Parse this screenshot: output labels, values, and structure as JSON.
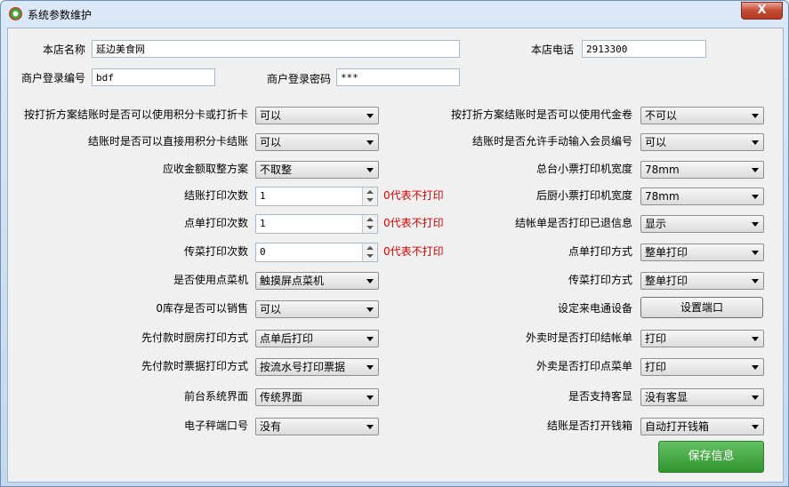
{
  "window": {
    "title": "系统参数维护",
    "close_label": "X"
  },
  "top": {
    "store_name_label": "本店名称",
    "store_name_value": "延边美食网",
    "store_phone_label": "本店电话",
    "store_phone_value": "2913300",
    "merchant_id_label": "商户登录编号",
    "merchant_id_value": "bdf",
    "merchant_pwd_label": "商户登录密码",
    "merchant_pwd_value": "***"
  },
  "left": [
    {
      "label": "按打折方案结账时是否可以使用积分卡或打折卡",
      "type": "select",
      "value": "可以"
    },
    {
      "label": "结账时是否可以直接用积分卡结账",
      "type": "select",
      "value": "可以"
    },
    {
      "label": "应收金额取整方案",
      "type": "select",
      "value": "不取整"
    },
    {
      "label": "结账打印次数",
      "type": "spin",
      "value": "1",
      "hint": "0代表不打印"
    },
    {
      "label": "点单打印次数",
      "type": "spin",
      "value": "1",
      "hint": "0代表不打印"
    },
    {
      "label": "传菜打印次数",
      "type": "spin",
      "value": "0",
      "hint": "0代表不打印"
    },
    {
      "label": "是否使用点菜机",
      "type": "select",
      "value": "触摸屏点菜机"
    },
    {
      "label": "0库存是否可以销售",
      "type": "select",
      "value": "可以"
    },
    {
      "label": "先付款时厨房打印方式",
      "type": "select",
      "value": "点单后打印"
    },
    {
      "label": "先付款时票据打印方式",
      "type": "select",
      "value": "按流水号打印票据"
    },
    {
      "label": "前台系统界面",
      "type": "select",
      "value": "传统界面"
    },
    {
      "label": "电子秤端口号",
      "type": "select",
      "value": "没有"
    }
  ],
  "right": [
    {
      "label": "按打折方案结账时是否可以使用代金卷",
      "type": "select",
      "value": "不可以"
    },
    {
      "label": "结账时是否允许手动输入会员编号",
      "type": "select",
      "value": "可以"
    },
    {
      "label": "总台小票打印机宽度",
      "type": "select",
      "value": "78mm"
    },
    {
      "label": "后厨小票打印机宽度",
      "type": "select",
      "value": "78mm"
    },
    {
      "label": "结帐单是否打印已退信息",
      "type": "select",
      "value": "显示"
    },
    {
      "label": "点单打印方式",
      "type": "select",
      "value": "整单打印"
    },
    {
      "label": "传菜打印方式",
      "type": "select",
      "value": "整单打印"
    },
    {
      "label": "设定来电通设备",
      "type": "button",
      "value": "设置端口"
    },
    {
      "label": "外卖时是否打印结帐单",
      "type": "select",
      "value": "打印"
    },
    {
      "label": "外卖是否打印点菜单",
      "type": "select",
      "value": "打印"
    },
    {
      "label": "是否支持客显",
      "type": "select",
      "value": "没有客显"
    },
    {
      "label": "结账是否打开钱箱",
      "type": "select",
      "value": "自动打开钱箱"
    }
  ],
  "save_label": "保存信息"
}
